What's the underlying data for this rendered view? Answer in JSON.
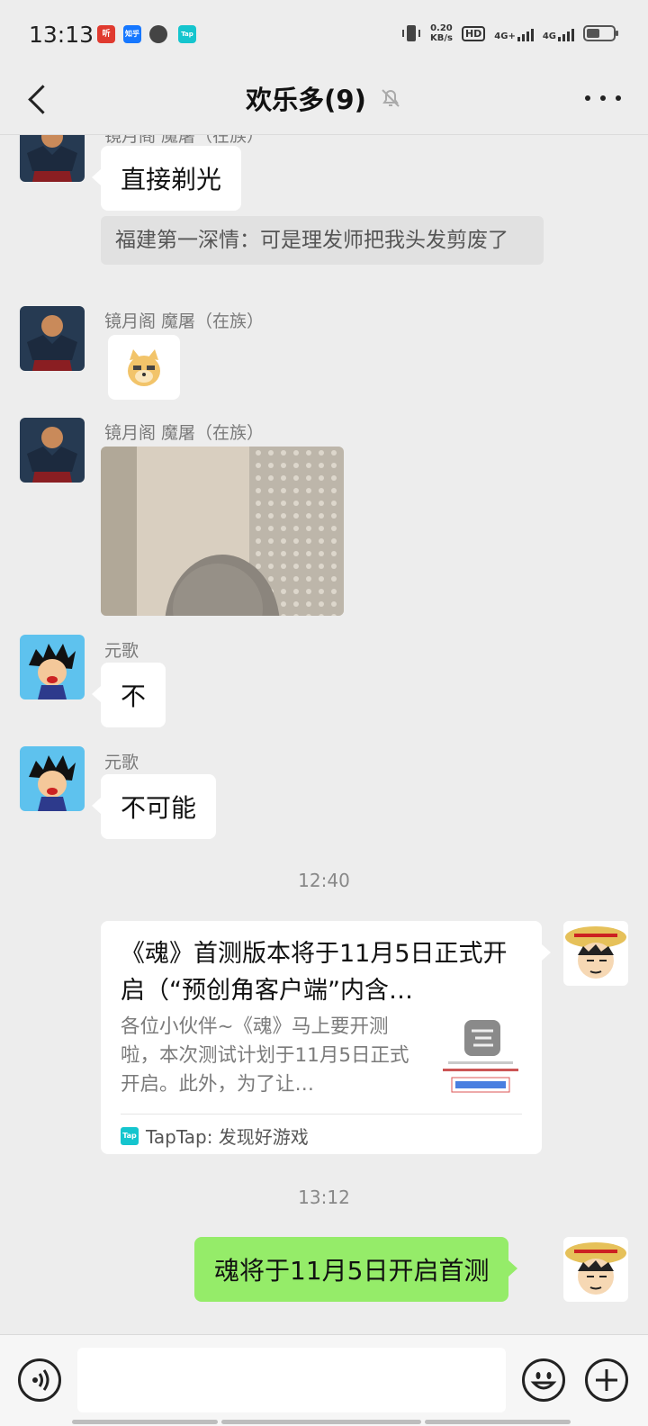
{
  "status_bar": {
    "time": "13:13",
    "app_icons": [
      "听",
      "知乎",
      "",
      "Tap"
    ],
    "net_speed_value": "0.20",
    "net_speed_unit": "KB/s",
    "hd_label": "HD",
    "sim1_label": "4G+",
    "sim2_label": "4G"
  },
  "header": {
    "title": "欢乐多(9)"
  },
  "messages": {
    "m1": {
      "sender": "镜月阁 魔屠（在族）",
      "text": "直接剃光"
    },
    "quote": {
      "text": "福建第一深情：可是理发师把我头发剪废了"
    },
    "m2": {
      "sender": "镜月阁 魔屠（在族）"
    },
    "m3": {
      "sender": "镜月阁 魔屠（在族）"
    },
    "m4": {
      "sender": "元歌",
      "text": "不"
    },
    "m5": {
      "sender": "元歌",
      "text": "不可能"
    },
    "time1": "12:40",
    "card": {
      "title": "《魂》首测版本将于11月5日正式开启（“预创角客户端”内含…",
      "desc": "各位小伙伴~《魂》马上要开测啦，本次测试计划于11月5日正式开启。此外，为了让…",
      "source": "TapTap: 发现好游戏",
      "tap_logo": "Tap"
    },
    "time2": "13:12",
    "m6": {
      "text": "魂将于11月5日开启首测"
    }
  },
  "input_bar": {
    "value": "",
    "placeholder": ""
  },
  "colors": {
    "background": "#ededed",
    "self_bubble": "#95ec69",
    "other_bubble": "#ffffff",
    "taptap_brand": "#15c5ce"
  }
}
